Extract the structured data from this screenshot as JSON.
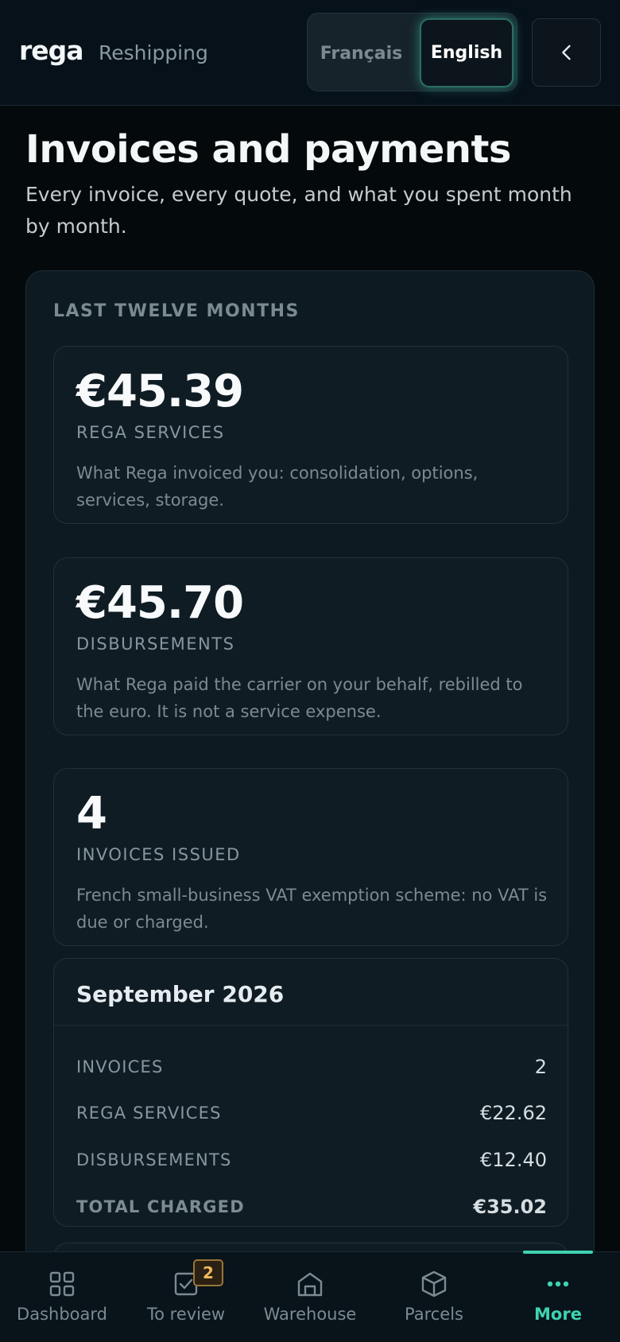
{
  "header": {
    "brand": "rega",
    "brand_sub": "Reshipping",
    "lang_fr": "Français",
    "lang_en": "English",
    "active_language": "English"
  },
  "page": {
    "title": "Invoices and payments",
    "subtitle": "Every invoice, every quote, and what you spent month by month."
  },
  "summary": {
    "title": "LAST TWELVE MONTHS",
    "cards": [
      {
        "value": "€45.39",
        "label": "REGA SERVICES",
        "desc": "What Rega invoiced you: consolidation, options, services, storage."
      },
      {
        "value": "€45.70",
        "label": "DISBURSEMENTS",
        "desc": "What Rega paid the carrier on your behalf, rebilled to the euro. It is not a service expense."
      },
      {
        "value": "4",
        "label": "INVOICES ISSUED",
        "desc": "French small-business VAT exemption scheme: no VAT is due or charged."
      }
    ]
  },
  "months": [
    {
      "title": "September 2026",
      "rows": [
        {
          "label": "INVOICES",
          "value": "2"
        },
        {
          "label": "REGA SERVICES",
          "value": "€22.62"
        },
        {
          "label": "DISBURSEMENTS",
          "value": "€12.40"
        },
        {
          "label": "TOTAL CHARGED",
          "value": "€35.02"
        }
      ]
    }
  ],
  "nav": {
    "items": [
      {
        "label": "Dashboard",
        "icon": "grid-icon"
      },
      {
        "label": "To review",
        "icon": "checklist-icon",
        "badge": "2"
      },
      {
        "label": "Warehouse",
        "icon": "warehouse-icon"
      },
      {
        "label": "Parcels",
        "icon": "box-icon"
      },
      {
        "label": "More",
        "icon": "more-dots-icon",
        "active": true
      }
    ]
  },
  "colors": {
    "accent": "#3fd3b0",
    "badge": "#f0b85a",
    "background": "#04090c"
  }
}
